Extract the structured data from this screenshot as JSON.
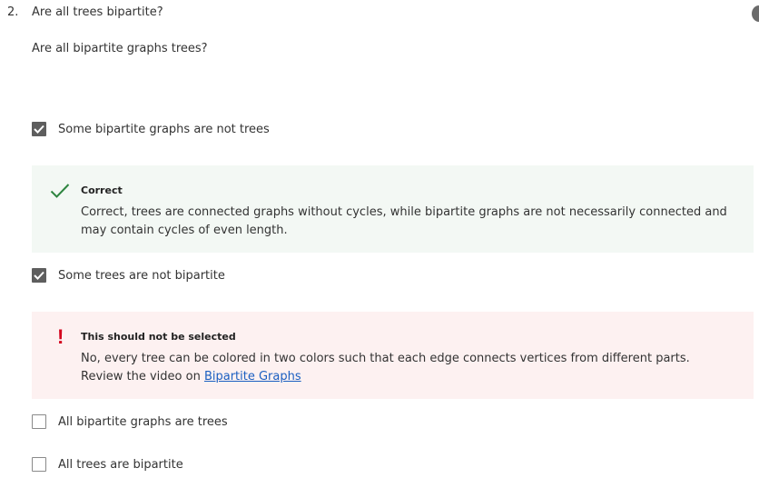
{
  "question": {
    "number": "2.",
    "title": "Are all trees bipartite?",
    "subtitle": "Are all bipartite graphs trees?"
  },
  "options": [
    {
      "label": "Some bipartite graphs are not trees",
      "checked": true,
      "feedback": {
        "status": "correct",
        "icon": "checkmark-icon",
        "title": "Correct",
        "text": "Correct, trees are connected graphs without cycles, while bipartite graphs are not necessarily connected and may contain cycles of even length.",
        "color": "#2e8540"
      }
    },
    {
      "label": "Some trees are not bipartite",
      "checked": true,
      "feedback": {
        "status": "incorrect",
        "icon": "exclamation-icon",
        "title": "This should not be selected",
        "text_before_link": "No, every tree can be colored in two colors such that each edge connects vertices from different parts. Review the video on ",
        "link_text": "Bipartite Graphs",
        "color": "#d3001c"
      }
    },
    {
      "label": "All bipartite graphs are trees",
      "checked": false
    },
    {
      "label": "All trees are bipartite",
      "checked": false
    }
  ]
}
